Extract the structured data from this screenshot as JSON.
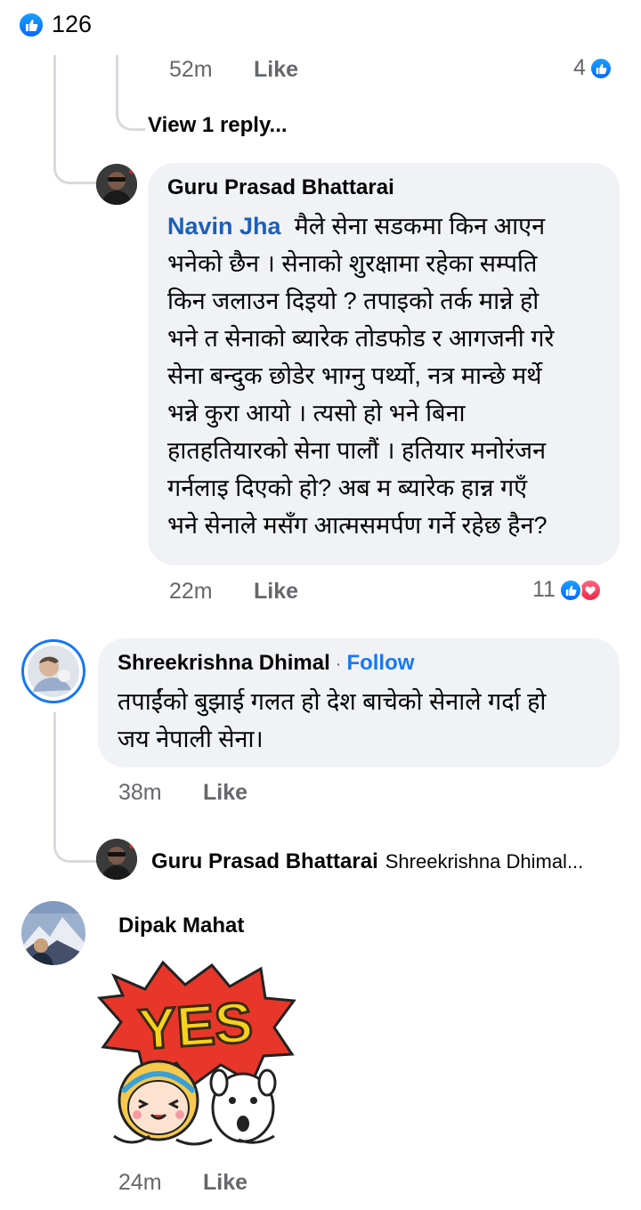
{
  "top_reactions": {
    "count": "126"
  },
  "comment_prev_reply": {
    "time": "52m",
    "like_label": "Like",
    "reaction_count": "4"
  },
  "view_replies": {
    "label": "View 1 reply..."
  },
  "reply_guru_1": {
    "author": "Guru Prasad Bhattarai",
    "mention": "Navin Jha",
    "lines": [
      "मैले सेना सडकमा किन आएन",
      "भनेको छैन । सेनाको शुरक्षामा रहेका सम्पति",
      "किन जलाउन दिइयो ? तपाइको तर्क मान्ने हो",
      "भने त सेनाको ब्यारेक तोडफोड र आगजनी गरे",
      "सेना बन्दुक छोडेर भाग्नु पर्थ्यो, नत्र मान्छे मर्थे",
      "भन्ने कुरा आयो । त्यसो हो भने बिना",
      "हातहतियारको सेना पालौं । हतियार मनोरंजन",
      "गर्नलाइ दिएको हो? अब म ब्यारेक हान्न गएँ",
      "भने सेनाले मसँग आत्मसमर्पण गर्ने रहेछ हैन?"
    ],
    "time": "22m",
    "like_label": "Like",
    "reaction_count": "11"
  },
  "comment_shreekrishna": {
    "author": "Shreekrishna Dhimal",
    "follow_label": "Follow",
    "separator": "·",
    "lines": [
      "तपाईंको बुझाई गलत हो देश बाचेको सेनाले गर्दा हो",
      "जय नेपाली सेना।"
    ],
    "time": "38m",
    "like_label": "Like"
  },
  "reply_guru_2": {
    "author": "Guru Prasad Bhattarai",
    "preview": "Shreekrishna Dhimal..."
  },
  "comment_dipak": {
    "author": "Dipak Mahat",
    "sticker_text": "YES",
    "time": "24m",
    "like_label": "Like"
  },
  "colors": {
    "like_blue": "#0866ff",
    "love_red": "#f0284a",
    "mention_blue": "#1d5fb8",
    "bubble": "#f0f2f5"
  }
}
